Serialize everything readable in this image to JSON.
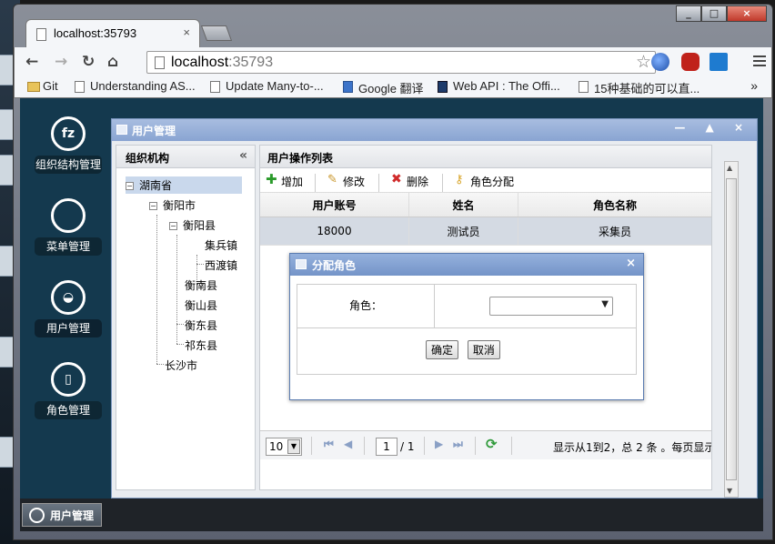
{
  "browser": {
    "tab_title": "localhost:35793",
    "tab_close": "×",
    "url_host": "localhost",
    "url_port": ":35793",
    "bookmarks": [
      {
        "label": "Git"
      },
      {
        "label": "Understanding AS..."
      },
      {
        "label": "Update Many-to-..."
      },
      {
        "label": "Google 翻译"
      },
      {
        "label": "Web API : The Offi..."
      },
      {
        "label": "15种基础的可以直..."
      }
    ],
    "more_bookmarks": "»"
  },
  "sidebar": {
    "items": [
      {
        "label": "组织结构管理"
      },
      {
        "label": "菜单管理"
      },
      {
        "label": "用户管理"
      },
      {
        "label": "角色管理"
      }
    ]
  },
  "panel": {
    "title": "用户管理",
    "tools": "— ▲ ×"
  },
  "org": {
    "title": "组织机构",
    "collapse": "«",
    "tree": [
      "湖南省",
      "衡阳市",
      "衡阳县",
      "集兵镇",
      "西渡镇",
      "衡南县",
      "衡山县",
      "衡东县",
      "祁东县",
      "长沙市"
    ]
  },
  "users": {
    "title": "用户操作列表",
    "toolbar": {
      "add": "增加",
      "edit": "修改",
      "delete": "删除",
      "assign_role": "角色分配"
    },
    "columns": [
      "用户账号",
      "姓名",
      "角色名称"
    ],
    "rows": [
      {
        "account": "18000",
        "name": "测试员",
        "role": "采集员"
      }
    ],
    "pager": {
      "page_size": "10",
      "page": "1",
      "total_pages": "/ 1",
      "info": "显示从1到2，总 2 条 。每页显示"
    }
  },
  "dialog": {
    "title": "分配角色",
    "close": "×",
    "role_label": "角色：",
    "role_value": "",
    "ok": "确定",
    "cancel": "取消"
  },
  "taskbar": {
    "label": "用户管理"
  },
  "colors": {
    "app_bg": "#14394e",
    "panel_header": "#89a4d2",
    "dialog_header": "#7494c8",
    "selected_row": "#d4dae3"
  }
}
